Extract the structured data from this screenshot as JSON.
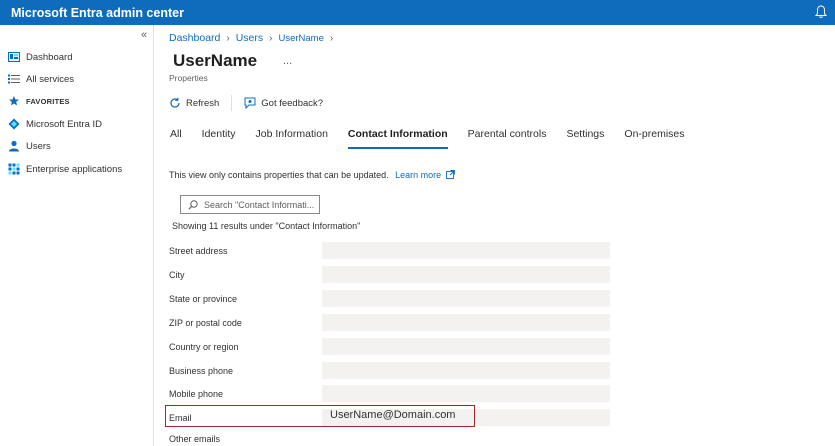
{
  "app": {
    "title": "Microsoft Entra admin center"
  },
  "sidebar": {
    "collapse_glyph": "«",
    "items": [
      {
        "label": "Dashboard",
        "icon": "dashboard-icon"
      },
      {
        "label": "All services",
        "icon": "list-icon"
      },
      {
        "label": "FAVORITES",
        "icon": "star-icon"
      },
      {
        "label": "Microsoft Entra ID",
        "icon": "entra-icon"
      },
      {
        "label": "Users",
        "icon": "user-icon"
      },
      {
        "label": "Enterprise applications",
        "icon": "apps-grid-icon"
      }
    ]
  },
  "breadcrumb": {
    "items": [
      "Dashboard",
      "Users",
      "UserName"
    ]
  },
  "page": {
    "title": "UserName",
    "subtitle": "Properties",
    "more": "..."
  },
  "toolbar": {
    "refresh": "Refresh",
    "feedback": "Got feedback?"
  },
  "tabs": [
    "All",
    "Identity",
    "Job Information",
    "Contact Information",
    "Parental controls",
    "Settings",
    "On-premises"
  ],
  "active_tab": "Contact Information",
  "info": {
    "text": "This view only contains properties that can be updated.",
    "link": "Learn more"
  },
  "search": {
    "placeholder": "Search \"Contact Informati..."
  },
  "results": {
    "text": "Showing 11 results under \"Contact Information\""
  },
  "fields": [
    {
      "label": "Street address",
      "value": ""
    },
    {
      "label": "City",
      "value": ""
    },
    {
      "label": "State or province",
      "value": ""
    },
    {
      "label": "ZIP or postal code",
      "value": ""
    },
    {
      "label": "Country or region",
      "value": ""
    },
    {
      "label": "Business phone",
      "value": ""
    },
    {
      "label": "Mobile phone",
      "value": ""
    },
    {
      "label": "Email",
      "value": "UserName@Domain.com"
    },
    {
      "label": "Other emails",
      "value": ""
    }
  ],
  "colors": {
    "brand": "#0f6cbd",
    "highlight": "#a4262c",
    "field_bg": "#f3f2f1"
  }
}
